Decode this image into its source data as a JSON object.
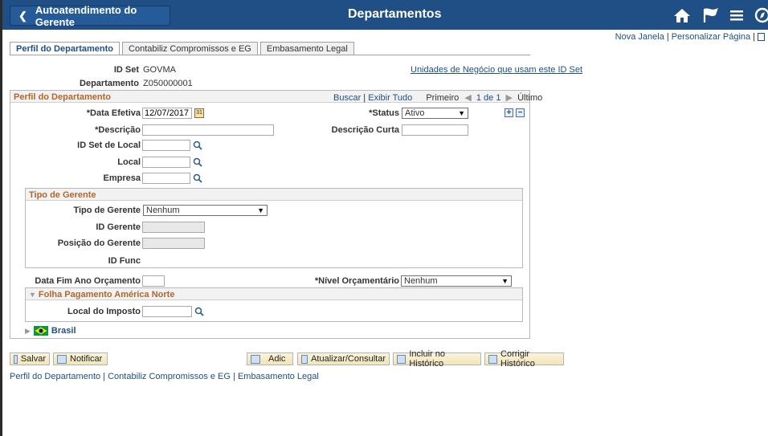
{
  "header": {
    "back_label": "Autoatendimento do Gerente",
    "title": "Departamentos"
  },
  "top_links": {
    "new_window": "Nova Janela",
    "personalize": "Personalizar Página"
  },
  "tabs": [
    {
      "label": "Perfil do Departamento"
    },
    {
      "label": "Contabiliz Compromissos e EG"
    },
    {
      "label": "Embasamento Legal"
    }
  ],
  "setid": {
    "label": "ID Set",
    "value": "GOVMA",
    "link": "Unidades de Negócio que usam este ID Set"
  },
  "dept": {
    "label": "Departamento",
    "value": "Z050000001"
  },
  "profile": {
    "title": "Perfil do Departamento",
    "find": "Buscar",
    "view_all": "Exibir Tudo",
    "first": "Primeiro",
    "count": "1 de 1",
    "last": "Último",
    "eff_date_label": "*Data Efetiva",
    "eff_date_value": "12/07/2017",
    "status_label": "*Status",
    "status_value": "Ativo",
    "descr_label": "*Descrição",
    "short_descr_label": "Descrição Curta",
    "location_setid_label": "ID Set de Local",
    "location_label": "Local",
    "company_label": "Empresa"
  },
  "manager": {
    "title": "Tipo de Gerente",
    "type_label": "Tipo de Gerente",
    "type_value": "Nenhum",
    "id_label": "ID Gerente",
    "position_label": "Posição do Gerente",
    "func_label": "ID Func"
  },
  "budget": {
    "end_label": "Data Fim Ano Orçamento",
    "level_label": "*Nível Orçamentário",
    "level_value": "Nenhum"
  },
  "payroll": {
    "title": "Folha Pagamento América Norte",
    "tax_label": "Local do Imposto"
  },
  "brasil": {
    "title": "Brasil"
  },
  "buttons": {
    "save": "Salvar",
    "notify": "Notificar",
    "add": "Adic",
    "update": "Atualizar/Consultar",
    "include_history": "Incluir no Histórico",
    "correct_history": "Corrigir Histórico"
  },
  "bottom_links": [
    "Perfil do Departamento",
    "Contabiliz Compromissos e EG",
    "Embasamento Legal"
  ],
  "colors": {
    "header_bg": "#1f4f84",
    "section_text": "#b0672a",
    "link": "#1f4f84"
  }
}
